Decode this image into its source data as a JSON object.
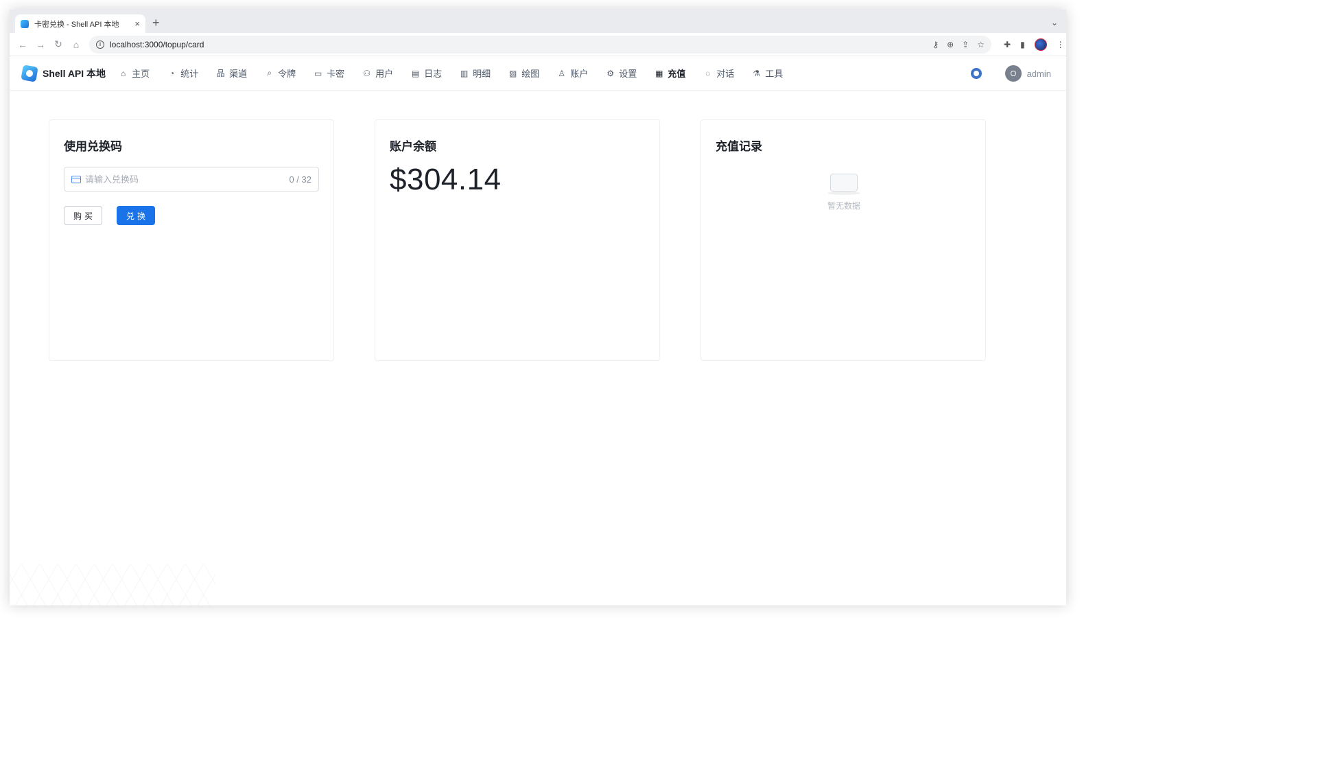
{
  "browser": {
    "tab_title": "卡密兑换 - Shell API 本地",
    "new_tab": "+",
    "tab_close": "×",
    "url": "localhost:3000/topup/card"
  },
  "app": {
    "brand": "Shell API 本地",
    "nav": [
      {
        "label": "主页",
        "icon": "home-icon"
      },
      {
        "label": "统计",
        "icon": "pie-chart-icon"
      },
      {
        "label": "渠道",
        "icon": "sitemap-icon"
      },
      {
        "label": "令牌",
        "icon": "search-icon"
      },
      {
        "label": "卡密",
        "icon": "credit-card-icon"
      },
      {
        "label": "用户",
        "icon": "user-group-icon"
      },
      {
        "label": "日志",
        "icon": "file-search-icon"
      },
      {
        "label": "明细",
        "icon": "file-list-icon"
      },
      {
        "label": "绘图",
        "icon": "image-icon"
      },
      {
        "label": "账户",
        "icon": "user-icon"
      },
      {
        "label": "设置",
        "icon": "gear-icon"
      },
      {
        "label": "充值",
        "icon": "store-icon"
      },
      {
        "label": "对话",
        "icon": "chat-icon"
      },
      {
        "label": "工具",
        "icon": "flask-icon"
      }
    ],
    "active_nav": "充值",
    "username": "admin"
  },
  "redeem_card": {
    "title": "使用兑换码",
    "input_placeholder": "请输入兑换码",
    "input_value": "",
    "counter": "0 / 32",
    "buy_label": "购买",
    "redeem_label": "兑换"
  },
  "balance_card": {
    "title": "账户余额",
    "amount": "$304.14"
  },
  "history_card": {
    "title": "充值记录",
    "empty_text": "暂无数据"
  },
  "colors": {
    "accent": "#1a73e8",
    "text_primary": "#1d2129",
    "text_secondary": "#4e5969"
  }
}
